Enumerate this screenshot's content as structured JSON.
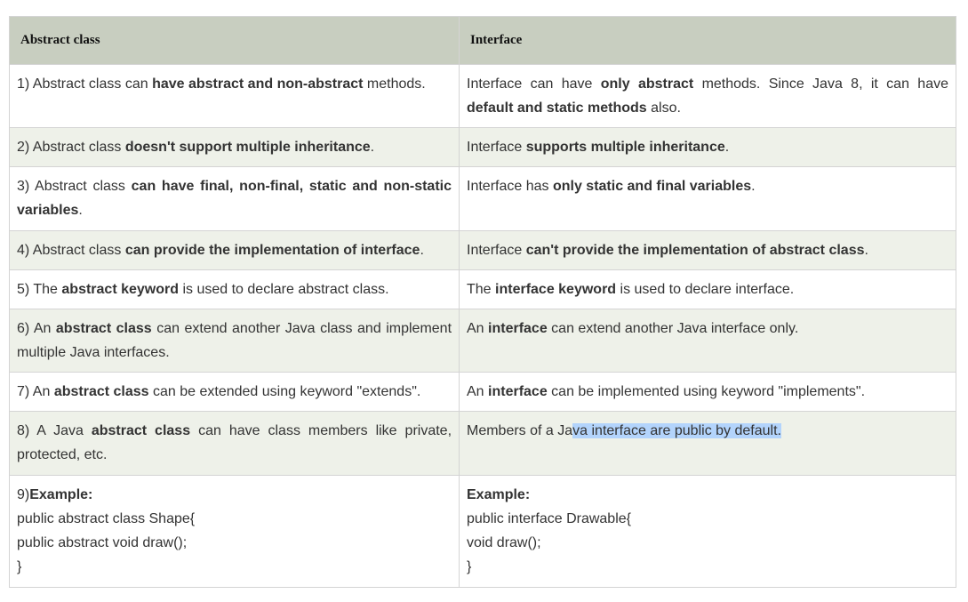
{
  "table": {
    "headers": {
      "abstract": "Abstract class",
      "interface": "Interface"
    },
    "rows": [
      {
        "abstract": {
          "a": "1) Abstract class can ",
          "b": "have abstract and non-abstract",
          "c": " methods."
        },
        "interface": {
          "a": "Interface can have ",
          "b": "only abstract",
          "c": " methods. Since Java 8, it can have ",
          "d": "default and static methods",
          "e": " also."
        }
      },
      {
        "abstract": {
          "a": "2) Abstract class ",
          "b": "doesn't support multiple inheritance",
          "c": "."
        },
        "interface": {
          "a": "Interface ",
          "b": "supports multiple inheritance",
          "c": "."
        }
      },
      {
        "abstract": {
          "a": "3) Abstract class ",
          "b": "can have final, non-final, static and non-static variables",
          "c": "."
        },
        "interface": {
          "a": "Interface has ",
          "b": "only static and final variables",
          "c": "."
        }
      },
      {
        "abstract": {
          "a": "4) Abstract class ",
          "b": "can provide the implementation of interface",
          "c": "."
        },
        "interface": {
          "a": "Interface ",
          "b": "can't provide the implementation of abstract class",
          "c": "."
        }
      },
      {
        "abstract": {
          "a": "5) The ",
          "b": "abstract keyword",
          "c": " is used to declare abstract class."
        },
        "interface": {
          "a": "The ",
          "b": "interface keyword",
          "c": " is used to declare interface."
        }
      },
      {
        "abstract": {
          "a": "6) An ",
          "b": "abstract class",
          "c": " can extend another Java class and implement multiple Java interfaces."
        },
        "interface": {
          "a": "An ",
          "b": "interface",
          "c": " can extend another Java interface only."
        }
      },
      {
        "abstract": {
          "a": "7) An ",
          "b": "abstract class",
          "c": " can be extended using keyword \"extends\"."
        },
        "interface": {
          "a": "An ",
          "b": "interface",
          "c": " can be implemented using keyword \"implements\"."
        }
      },
      {
        "abstract": {
          "a": "8) A Java ",
          "b": "abstract class",
          "c": " can have class members like private, protected, etc."
        },
        "interface": {
          "a": "Members of a Ja",
          "sel": "va interface are public by default."
        }
      },
      {
        "abstract": {
          "num": "9)",
          "title": "Example:",
          "code": [
            "public abstract class Shape{",
            "public abstract void draw();",
            "}"
          ]
        },
        "interface": {
          "title": "Example:",
          "code": [
            "public interface Drawable{",
            "void draw();",
            "}"
          ]
        }
      }
    ]
  }
}
